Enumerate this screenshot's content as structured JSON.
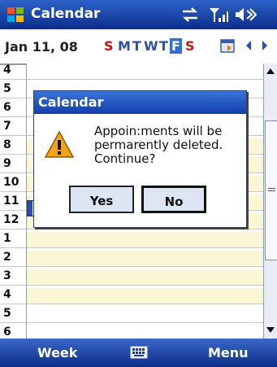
{
  "app": {
    "title": "Calendar"
  },
  "datebar": {
    "date": "Jan 11, 08",
    "days": [
      {
        "label": "S",
        "kind": "weekend"
      },
      {
        "label": "M",
        "kind": "weekday"
      },
      {
        "label": "T",
        "kind": "weekday"
      },
      {
        "label": "W",
        "kind": "weekday"
      },
      {
        "label": "T",
        "kind": "weekday"
      },
      {
        "label": "F",
        "kind": "selected"
      },
      {
        "label": "S",
        "kind": "weekend"
      }
    ]
  },
  "hours": [
    {
      "label": "4",
      "shaded": false
    },
    {
      "label": "5",
      "shaded": false
    },
    {
      "label": "6",
      "shaded": false
    },
    {
      "label": "7",
      "shaded": false
    },
    {
      "label": "8",
      "shaded": true
    },
    {
      "label": "9",
      "shaded": true
    },
    {
      "label": "10",
      "shaded": true
    },
    {
      "label": "11",
      "shaded": true
    },
    {
      "label": "12",
      "shaded": true
    },
    {
      "label": "1",
      "shaded": true
    },
    {
      "label": "2",
      "shaded": true
    },
    {
      "label": "3",
      "shaded": true
    },
    {
      "label": "4",
      "shaded": true
    },
    {
      "label": "5",
      "shaded": false
    },
    {
      "label": "6",
      "shaded": false
    }
  ],
  "dialog": {
    "title": "Calendar",
    "message_lines": [
      "Appoin:ments will be",
      "permarently deleted.",
      "Continue?"
    ],
    "yes_label": "Yes",
    "no_label": "No"
  },
  "softkeys": {
    "left": "Week",
    "right": "Menu"
  },
  "colors": {
    "shaded": "#fbf7d6",
    "unshaded": "#ffffff",
    "accent": "#2f6fd6"
  }
}
